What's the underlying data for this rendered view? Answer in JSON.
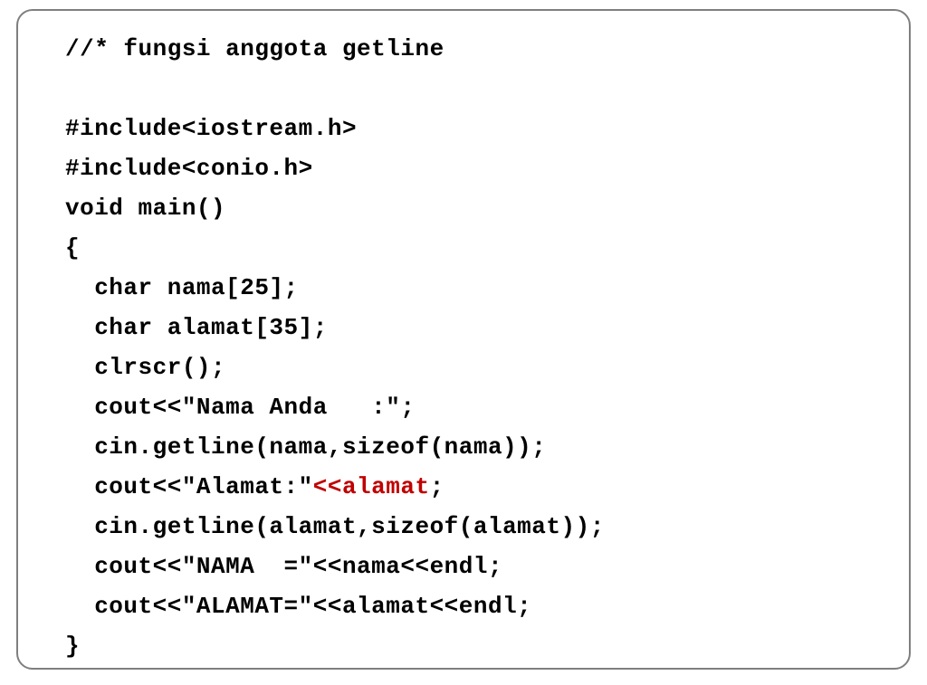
{
  "code": {
    "l0": "//* fungsi anggota getline",
    "l1": "#include<iostream.h>",
    "l2": "#include<conio.h>",
    "l3": "void main()",
    "l4": "{",
    "l5": "  char nama[25];",
    "l6": "  char alamat[35];",
    "l7": "  clrscr();",
    "l8": "  cout<<\"Nama Anda   :\";",
    "l9": "  cin.getline(nama,sizeof(nama));",
    "l10a": "  cout<<\"Alamat:\"",
    "l10b": "<<alamat",
    "l10c": ";",
    "l11": "  cin.getline(alamat,sizeof(alamat));",
    "l12": "  cout<<\"NAMA  =\"<<nama<<endl;",
    "l13": "  cout<<\"ALAMAT=\"<<alamat<<endl;",
    "l14": "}"
  }
}
